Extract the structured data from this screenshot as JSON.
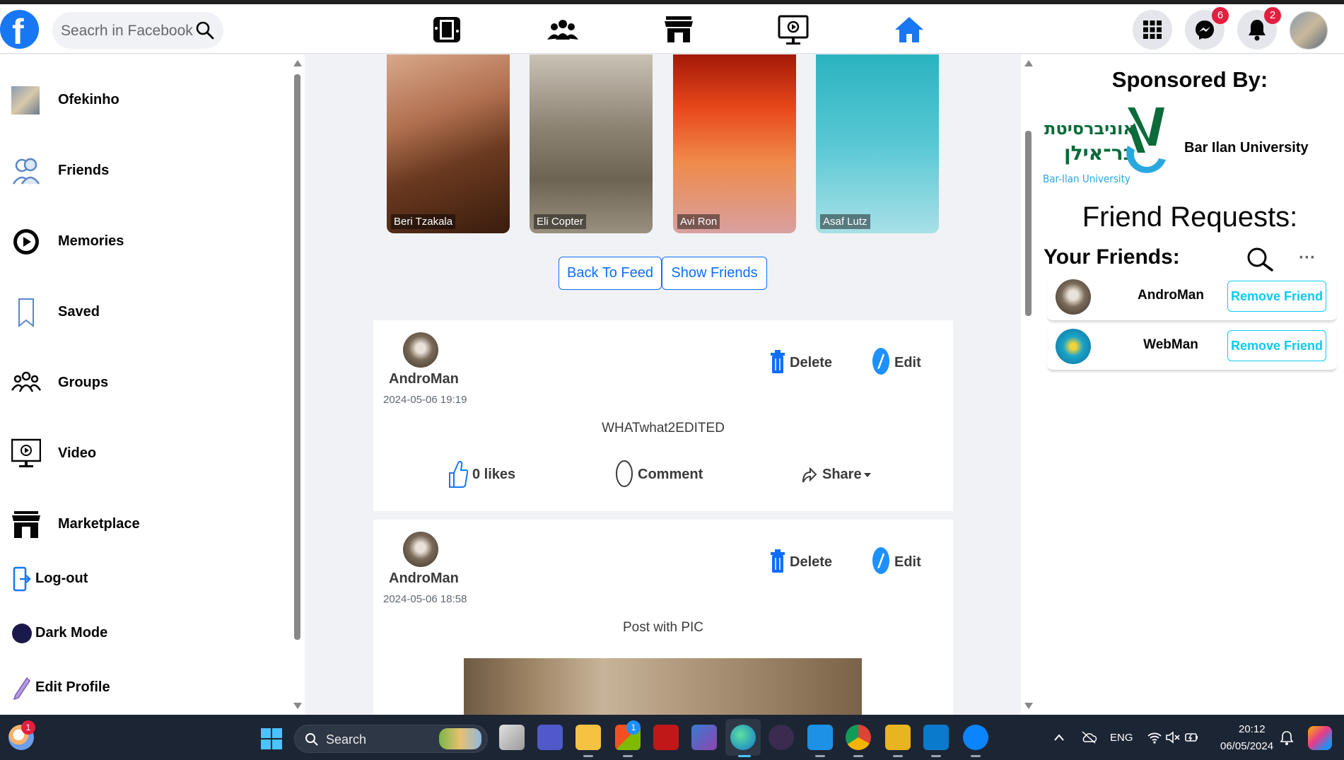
{
  "header": {
    "logo_letter": "f",
    "search_placeholder": "Seacrh in Facebook",
    "messenger_badge": "6",
    "notifications_badge": "2"
  },
  "sidebar": {
    "items": [
      {
        "label": "Ofekinho"
      },
      {
        "label": "Friends"
      },
      {
        "label": "Memories"
      },
      {
        "label": "Saved"
      },
      {
        "label": "Groups"
      },
      {
        "label": "Video"
      },
      {
        "label": "Marketplace"
      },
      {
        "label": "Log-out"
      },
      {
        "label": "Dark Mode"
      },
      {
        "label": "Edit Profile"
      }
    ]
  },
  "stories": [
    {
      "name": "Beri Tzakala"
    },
    {
      "name": "Eli Copter"
    },
    {
      "name": "Avi Ron"
    },
    {
      "name": "Asaf Lutz"
    }
  ],
  "feed_buttons": {
    "back": "Back To Feed",
    "show_friends": "Show Friends"
  },
  "posts": [
    {
      "author": "AndroMan",
      "date": "2024-05-06 19:19",
      "text": "WHATwhat2EDITED",
      "delete_label": "Delete",
      "edit_label": "Edit",
      "likes_label": "0 likes",
      "comment_label": "Comment",
      "share_label": "Share"
    },
    {
      "author": "AndroMan",
      "date": "2024-05-06 18:58",
      "text": "Post with PIC",
      "delete_label": "Delete",
      "edit_label": "Edit"
    }
  ],
  "right": {
    "sponsored_title": "Sponsored By:",
    "sponsor_name": "Bar Ilan University",
    "sponsor_logo_text_he1": "אוניברסיטת",
    "sponsor_logo_text_he2": "בר־אילן",
    "sponsor_logo_text_en": "Bar-Ilan University",
    "friend_requests_title": "Friend Requests:",
    "your_friends_title": "Your Friends:",
    "more_label": "···",
    "friends": [
      {
        "name": "AndroMan",
        "button": "Remove Friend"
      },
      {
        "name": "WebMan",
        "button": "Remove Friend"
      }
    ]
  },
  "taskbar": {
    "search_label": "Search",
    "language": "ENG",
    "time": "20:12",
    "date": "06/05/2024",
    "weather_badge": "1",
    "store_badge": "1"
  },
  "colors": {
    "facebook_blue": "#1877f2",
    "bootstrap_primary": "#0d6efd",
    "bootstrap_info": "#0dcaf0",
    "badge_red": "#e41e3f"
  }
}
